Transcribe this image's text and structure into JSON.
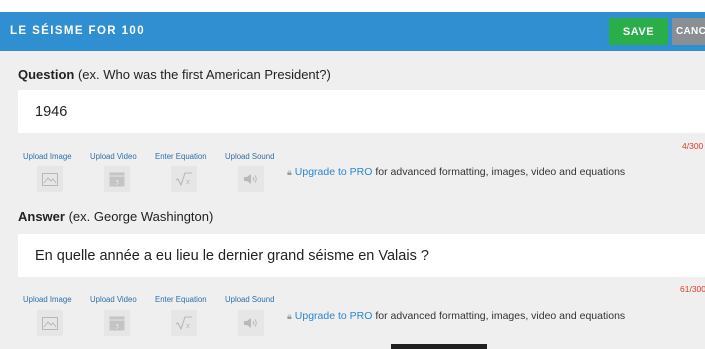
{
  "header": {
    "title": "LE SÉISME FOR 100",
    "save_label": "SAVE",
    "cancel_label": "CANCEL"
  },
  "question": {
    "label_bold": "Question",
    "label_hint": " (ex. Who was the first American President?)",
    "value": "1946",
    "counter": "4/300"
  },
  "answer": {
    "label_bold": "Answer",
    "label_hint": " (ex. George Washington)",
    "value": "En quelle année a eu lieu le dernier grand séisme en Valais ?",
    "counter": "61/300"
  },
  "media_toolbar": {
    "upload_image": "Upload Image",
    "upload_video": "Upload Video",
    "enter_equation": "Enter Equation",
    "upload_sound": "Upload Sound",
    "upgrade_link": "Upgrade to PRO",
    "upgrade_text": " for advanced formatting, images, video and equations"
  },
  "icons": [
    "image-icon",
    "video-icon",
    "equation-icon",
    "sound-icon",
    "lock-icon"
  ],
  "colors": {
    "header": "#2f8fd0",
    "save": "#2aae4a",
    "cancel": "#8a8f94",
    "counter": "#e03a2a",
    "link": "#2a86cf"
  }
}
